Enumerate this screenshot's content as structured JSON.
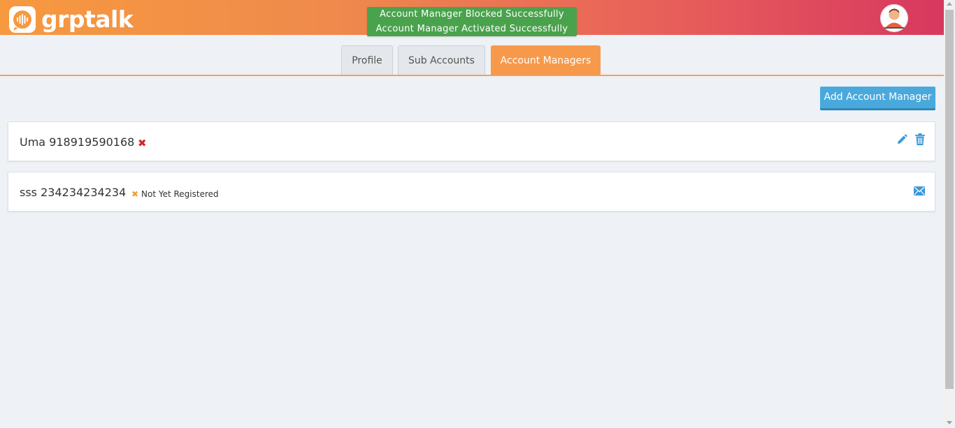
{
  "header": {
    "logo_text": "grptalk",
    "toasts": [
      "Account Manager Blocked Successfully",
      "Account Manager Activated Successfully"
    ]
  },
  "tabs": [
    {
      "label": "Profile",
      "active": false
    },
    {
      "label": "Sub Accounts",
      "active": false
    },
    {
      "label": "Account Managers",
      "active": true
    }
  ],
  "actions": {
    "add_label": "Add Account Manager"
  },
  "managers": [
    {
      "name": "Uma 918919590168",
      "status_icon": "blocked-x-icon",
      "status_text": "",
      "actions": [
        "edit-icon",
        "delete-icon"
      ]
    },
    {
      "name": "sss 234234234234",
      "status_icon": "pending-x-icon",
      "status_text": "Not Yet Registered",
      "actions": [
        "mail-icon"
      ]
    }
  ],
  "colors": {
    "header_start": "#f7993f",
    "header_end": "#d7385f",
    "active_tab": "#f7994a",
    "primary_button": "#4aa9dc",
    "toast": "#4aa34c",
    "blocked": "#d9252b",
    "pending": "#f0a030",
    "action_icon": "#3a9ad9"
  }
}
